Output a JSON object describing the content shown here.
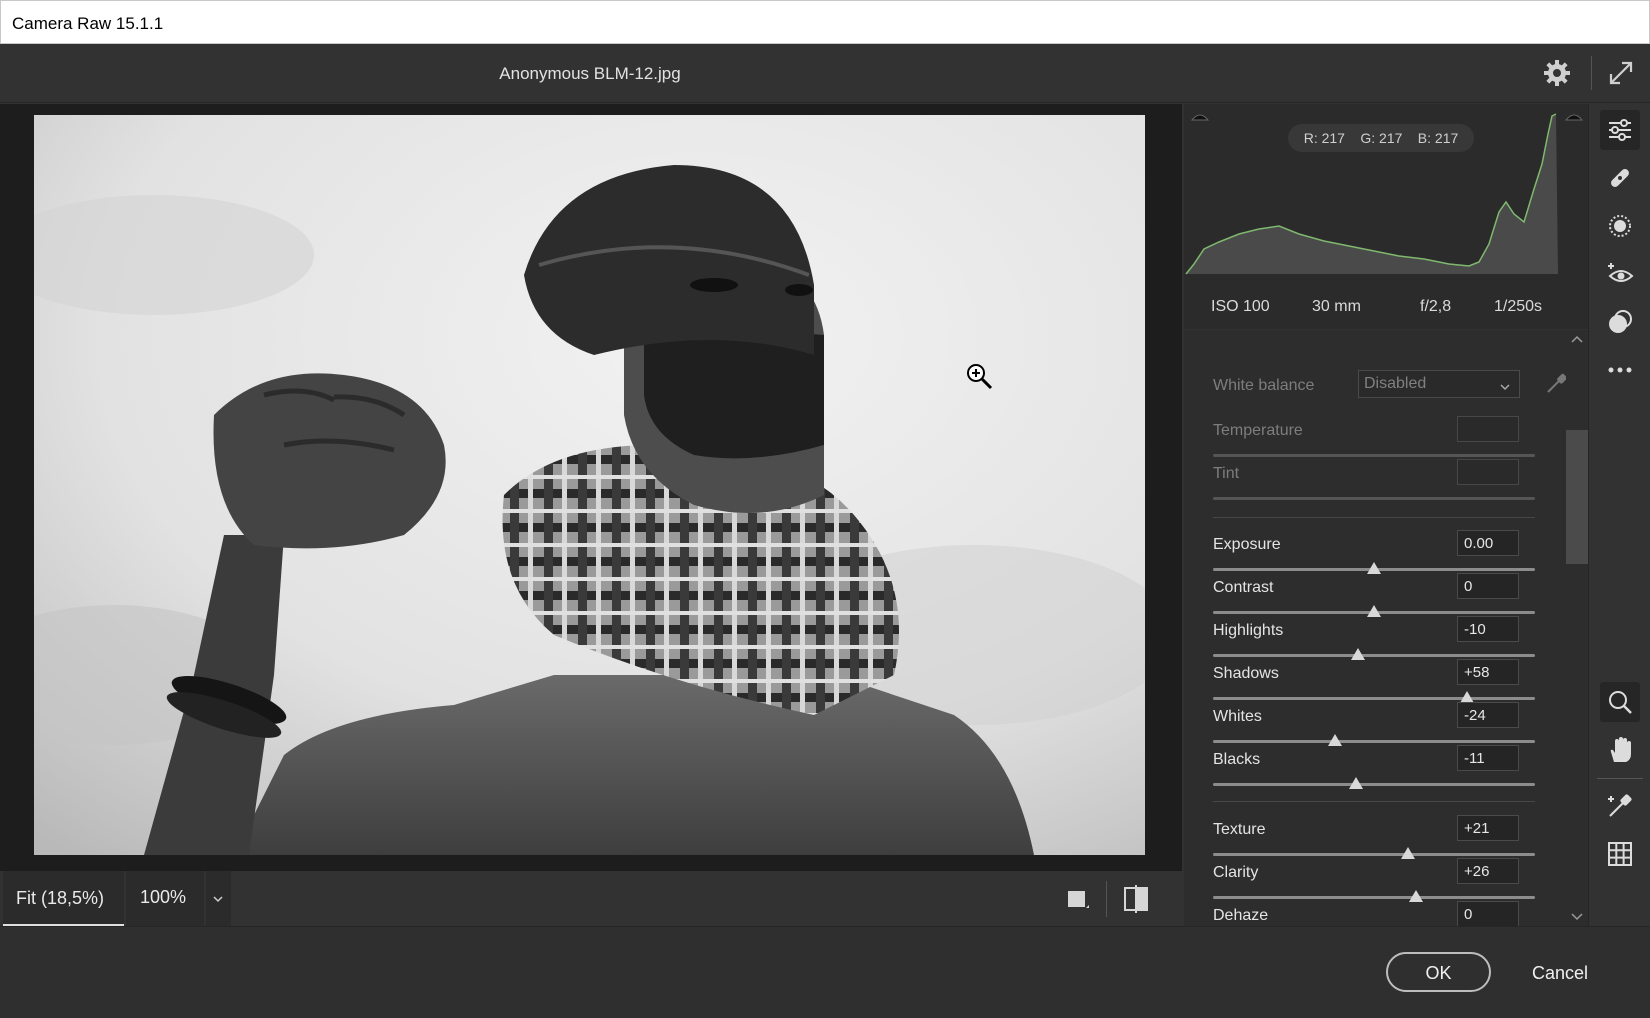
{
  "window": {
    "title": "Camera Raw 15.1.1"
  },
  "header": {
    "filename": "Anonymous BLM-12.jpg"
  },
  "histogram": {
    "readout": {
      "r": "R: 217",
      "g": "G: 217",
      "b": "B: 217"
    },
    "exif": {
      "iso": "ISO 100",
      "focal": "30 mm",
      "aperture": "f/2,8",
      "shutter": "1/250s"
    }
  },
  "white_balance": {
    "label": "White balance",
    "value": "Disabled"
  },
  "sliders_wb": [
    {
      "label": "Temperature",
      "value": ""
    },
    {
      "label": "Tint",
      "value": ""
    }
  ],
  "sliders_tone": [
    {
      "label": "Exposure",
      "value": "0.00",
      "level": 0.5
    },
    {
      "label": "Contrast",
      "value": "0",
      "level": 0.5
    },
    {
      "label": "Highlights",
      "value": "-10",
      "level": 0.45
    },
    {
      "label": "Shadows",
      "value": "+58",
      "level": 0.79
    },
    {
      "label": "Whites",
      "value": "-24",
      "level": 0.38
    },
    {
      "label": "Blacks",
      "value": "-11",
      "level": 0.445
    }
  ],
  "sliders_presence": [
    {
      "label": "Texture",
      "value": "+21",
      "level": 0.605
    },
    {
      "label": "Clarity",
      "value": "+26",
      "level": 0.63
    },
    {
      "label": "Dehaze",
      "value": "0",
      "level": 0.5
    }
  ],
  "zoom": {
    "fit": "Fit (18,5%)",
    "percent": "100%"
  },
  "footer": {
    "ok": "OK",
    "cancel": "Cancel"
  },
  "toolstrip": [
    "edit-icon",
    "healing-icon",
    "masking-icon",
    "red-eye-icon",
    "presets-icon",
    "more-icon",
    "zoom-icon",
    "hand-icon",
    "sampler-icon",
    "grid-icon"
  ],
  "colors": {
    "panel": "#2d2d2d",
    "app": "#323232",
    "histogram_line": "#7fb86e"
  }
}
